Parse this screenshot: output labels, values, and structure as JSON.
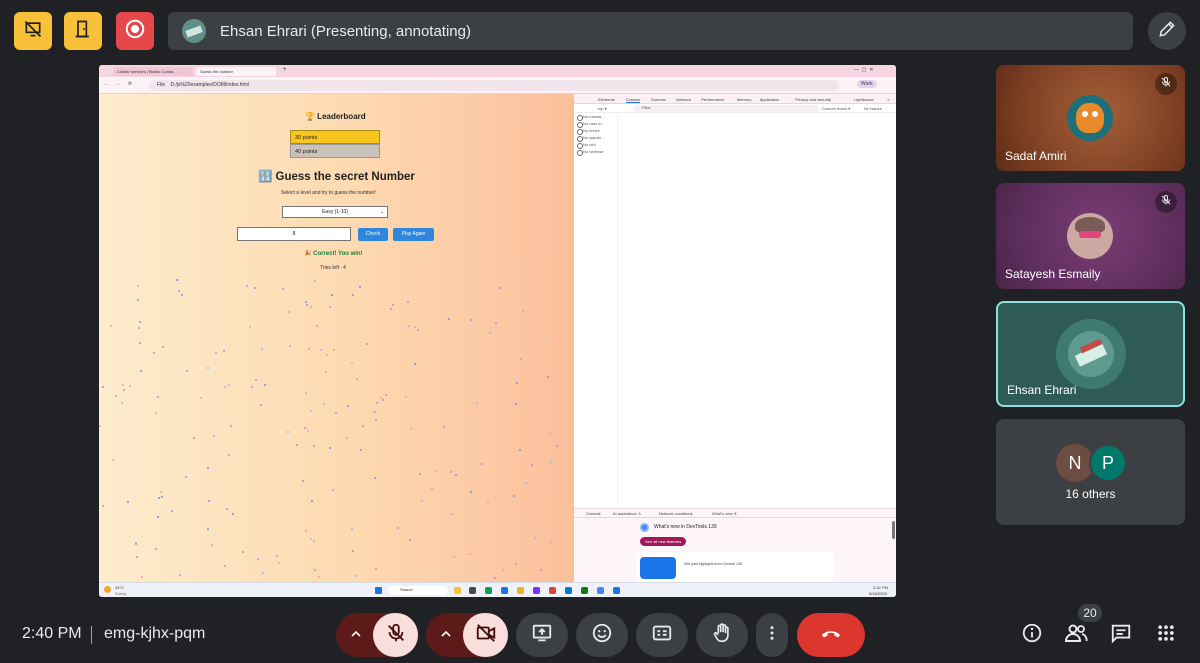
{
  "top_bar": {
    "presenter_title": "Ehsan Ehrari (Presenting, annotating)",
    "icons": [
      "presentation-off-icon",
      "door-exit-icon",
      "record-icon",
      "pencil-icon"
    ],
    "colors": {
      "yellow": "#f9c13a",
      "red": "#e5474a"
    }
  },
  "shared_screen": {
    "tabs": [
      "Cluster services | Elastic Contai…",
      "Guess the number"
    ],
    "address": "D:/js%20examples/DOM/index.html",
    "address_prefix": "File",
    "profile": "Work",
    "page": {
      "leaderboard_title": "🏆 Leaderboard",
      "leaderboard_items": [
        "30 points",
        "40 points"
      ],
      "game_title": "🔢 Guess the secret Number",
      "game_subtitle": "Select a level and try to guess the number!",
      "level_select": "Easy (1-10)",
      "guess_value": "8",
      "check_label": "Check",
      "play_again_label": "Play Again",
      "result": "🎉 Correct! You win!",
      "tries_left": "Tries left : 4"
    },
    "devtools": {
      "tabs": [
        "Elements",
        "Console",
        "Sources",
        "Network",
        "Performance",
        "Memory",
        "Application",
        "Privacy and security",
        "Lighthouse",
        "»"
      ],
      "context": "top",
      "filter_placeholder": "Filter",
      "levels": "Custom levels",
      "issues": "No Issues",
      "sidebar": [
        "No messa…",
        "No user m…",
        "No errors",
        "No warnin…",
        "No info",
        "No verbose"
      ],
      "bottom_tabs": [
        "Console",
        "AI assistance ⚠",
        "Network conditions",
        "What's new ✕"
      ],
      "whats_new_title": "What's new in DevTools 139",
      "see_all_label": "See all new features",
      "highlight_text": "See past highlights from Chrome 138"
    },
    "taskbar": {
      "weather_temp": "34°C",
      "weather_text": "Sunny",
      "search": "Search",
      "clock_time": "2:42 PM",
      "clock_date": "8/18/2025"
    }
  },
  "participants": [
    {
      "name": "Sadaf Amiri",
      "muted": true,
      "bg": "#8a4a2c"
    },
    {
      "name": "Satayesh Esmaily",
      "muted": true,
      "bg": "#5c2d5a"
    },
    {
      "name": "Ehsan Ehrari",
      "muted": false,
      "bg": "#2f5b56",
      "active": true
    },
    {
      "name": "16 others",
      "initials": [
        "N",
        "P"
      ]
    }
  ],
  "bottom_bar": {
    "time": "2:40 PM",
    "meeting_code": "emg-kjhx-pqm",
    "people_count": "20",
    "controls": [
      "mic-options",
      "mic-off",
      "camera-options",
      "camera-off",
      "present",
      "reactions",
      "captions",
      "raise-hand",
      "more-options",
      "leave-call"
    ],
    "right_controls": [
      "meeting-info",
      "people",
      "chat",
      "activities"
    ]
  }
}
